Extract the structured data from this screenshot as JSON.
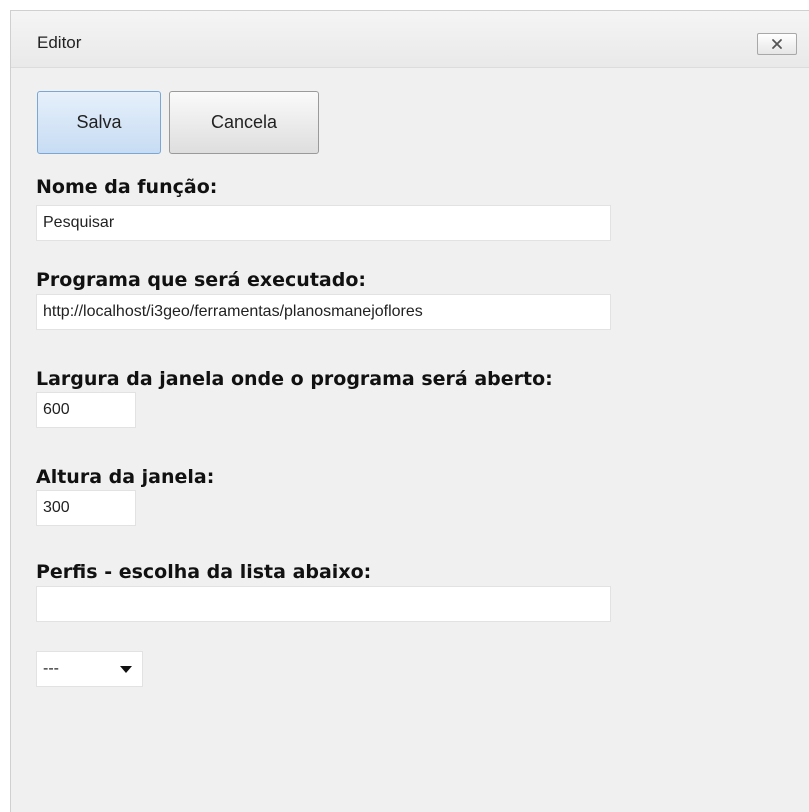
{
  "window": {
    "title": "Editor",
    "close_icon": "close-icon"
  },
  "toolbar": {
    "save_label": "Salva",
    "cancel_label": "Cancela"
  },
  "form": {
    "name": {
      "label": "Nome da função:",
      "value": "Pesquisar"
    },
    "program": {
      "label": "Programa que será executado:",
      "value": "http://localhost/i3geo/ferramentas/planosmanejoflores"
    },
    "width": {
      "label": "Largura da janela onde o programa será aberto:",
      "value": "600"
    },
    "height": {
      "label": "Altura da janela:",
      "value": "300"
    },
    "profiles": {
      "label": "Perfis - escolha da lista abaixo:",
      "value": ""
    },
    "profile_select": {
      "selected": "---"
    }
  },
  "colors": {
    "dialog_bg": "#f0f0f0",
    "save_button_bg": "#c7dcf3",
    "input_bg": "#ffffff"
  }
}
